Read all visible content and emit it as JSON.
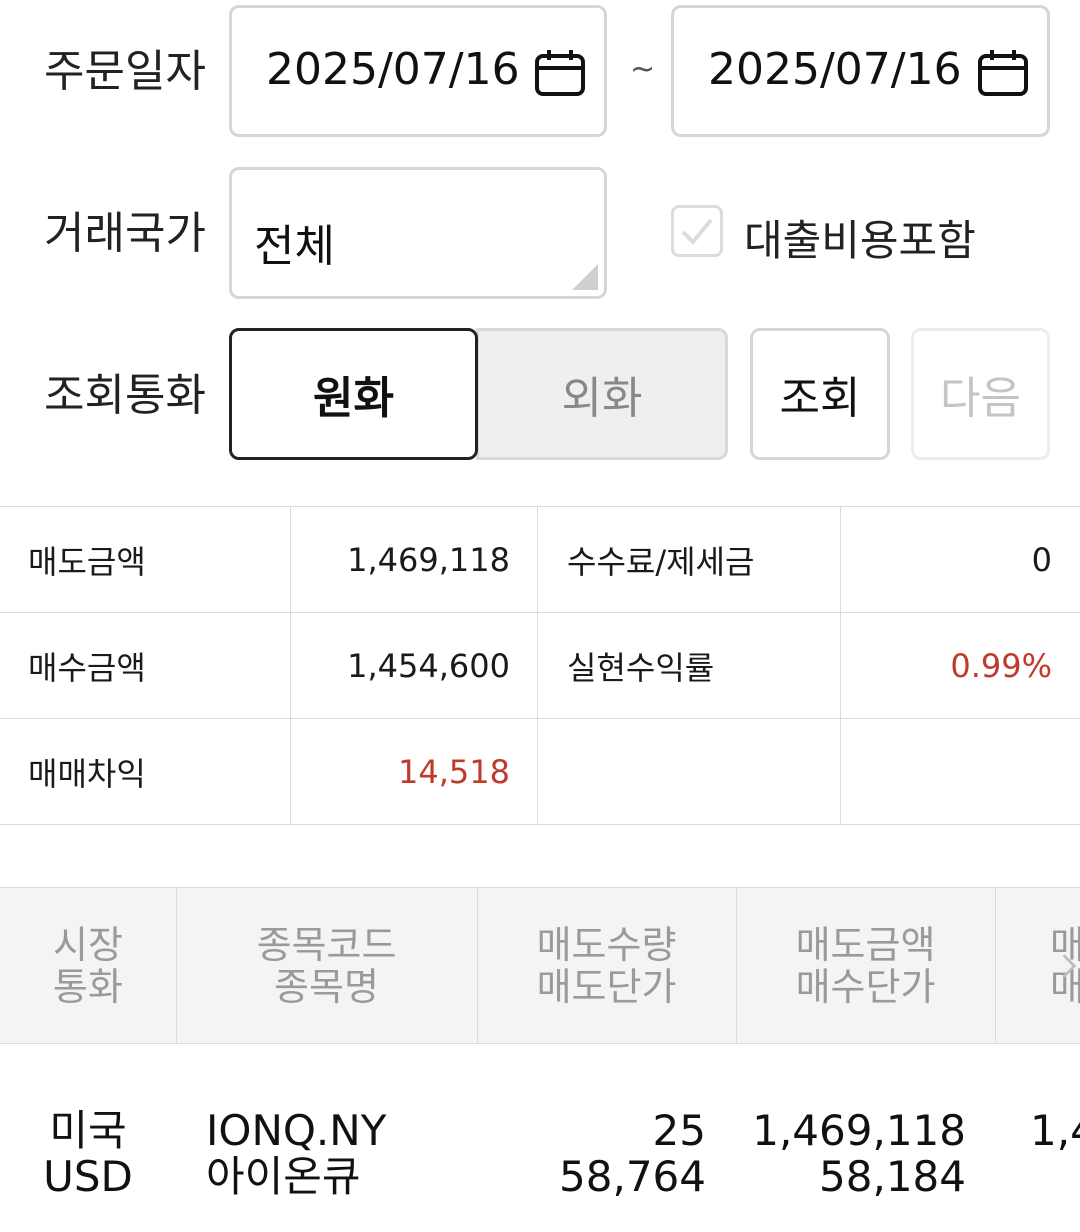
{
  "filters": {
    "order_date_label": "주문일자",
    "date_from": "2025/07/16",
    "date_sep": "~",
    "date_to": "2025/07/16",
    "country_label": "거래국가",
    "country_value": "전체",
    "loan_cost_label": "대출비용포함",
    "loan_cost_checked": false,
    "currency_label": "조회통화",
    "currency_options": [
      "원화",
      "외화"
    ],
    "currency_selected": "원화",
    "search_button": "조회",
    "next_button": "다음"
  },
  "summary": {
    "rows": [
      {
        "label1": "매도금액",
        "value1": "1,469,118",
        "label2": "수수료/제세금",
        "value2": "0"
      },
      {
        "label1": "매수금액",
        "value1": "1,454,600",
        "label2": "실현수익률",
        "value2": "0.99%"
      },
      {
        "label1": "매매차익",
        "value1": "14,518",
        "label2": "",
        "value2": ""
      }
    ]
  },
  "table": {
    "headers": [
      {
        "line1": "시장",
        "line2": "통화"
      },
      {
        "line1": "종목코드",
        "line2": "종목명"
      },
      {
        "line1": "매도수량",
        "line2": "매도단가"
      },
      {
        "line1": "매도금액",
        "line2": "매수단가"
      },
      {
        "line1": "매",
        "line2": "매"
      }
    ],
    "rows": [
      {
        "market": "미국",
        "currency": "USD",
        "code": "IONQ.NY",
        "name": "아이온큐",
        "sell_qty": "25",
        "sell_price": "58,764",
        "sell_amount": "1,469,118",
        "buy_price": "58,184",
        "next_col": "1,4"
      }
    ]
  },
  "colors": {
    "accent_red": "#c0392b",
    "border": "#d6d6d6",
    "header_bg": "#f4f4f6"
  }
}
